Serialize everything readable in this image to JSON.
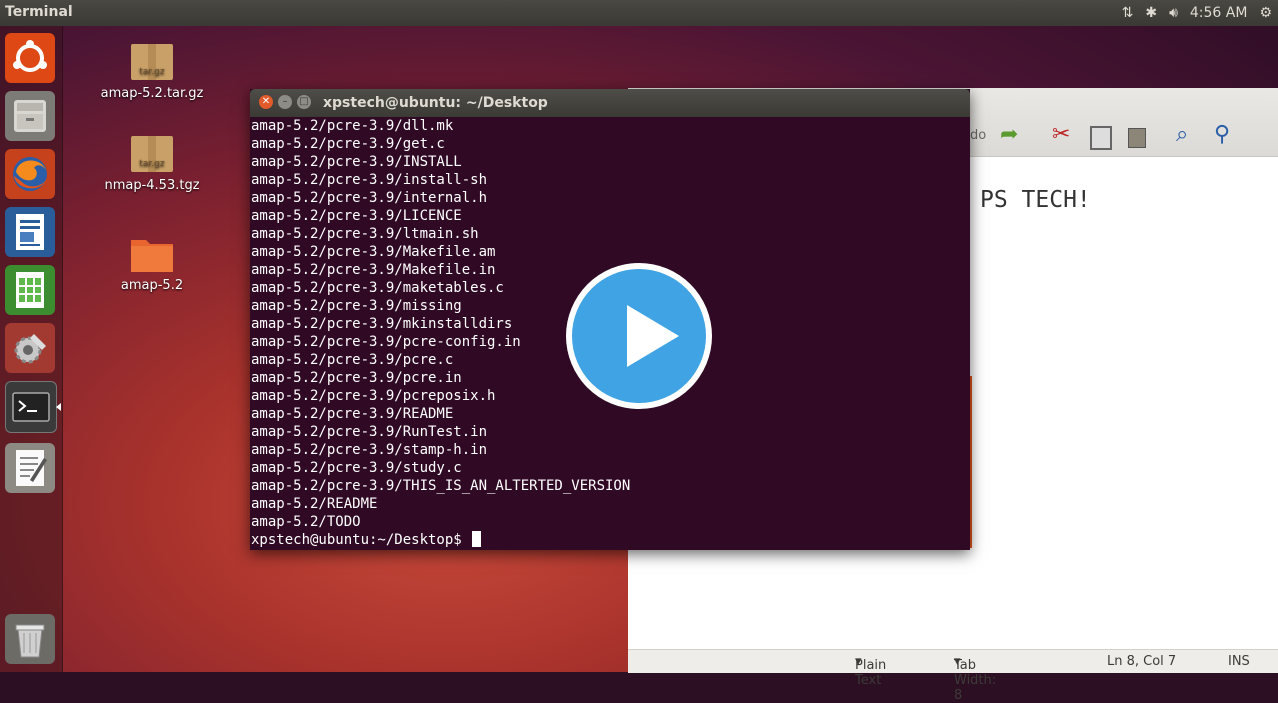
{
  "topbar": {
    "app_title": "Terminal",
    "time": "4:56 AM",
    "icons": [
      "network-icon",
      "bluetooth-icon",
      "volume-icon",
      "gear-icon"
    ]
  },
  "launcher": {
    "items": [
      {
        "name": "ubuntu-dash-icon"
      },
      {
        "name": "files-icon"
      },
      {
        "name": "firefox-icon"
      },
      {
        "name": "writer-icon"
      },
      {
        "name": "calc-icon"
      },
      {
        "name": "system-settings-icon"
      },
      {
        "name": "terminal-icon"
      },
      {
        "name": "text-editor-icon"
      },
      {
        "name": "trash-icon"
      }
    ]
  },
  "desktop": {
    "icons": [
      {
        "label": "amap-5.2.tar.gz",
        "badge": "tar.gz"
      },
      {
        "label": "nmap-4.53.tgz",
        "badge": "tar.gz"
      },
      {
        "label": "amap-5.2"
      }
    ]
  },
  "terminal": {
    "title": "xpstech@ubuntu: ~/Desktop",
    "lines": [
      "amap-5.2/pcre-3.9/dll.mk",
      "amap-5.2/pcre-3.9/get.c",
      "amap-5.2/pcre-3.9/INSTALL",
      "amap-5.2/pcre-3.9/install-sh",
      "amap-5.2/pcre-3.9/internal.h",
      "amap-5.2/pcre-3.9/LICENCE",
      "amap-5.2/pcre-3.9/ltmain.sh",
      "amap-5.2/pcre-3.9/Makefile.am",
      "amap-5.2/pcre-3.9/Makefile.in",
      "amap-5.2/pcre-3.9/maketables.c",
      "amap-5.2/pcre-3.9/missing",
      "amap-5.2/pcre-3.9/mkinstalldirs",
      "amap-5.2/pcre-3.9/pcre-config.in",
      "amap-5.2/pcre-3.9/pcre.c",
      "amap-5.2/pcre-3.9/pcre.in",
      "amap-5.2/pcre-3.9/pcreposix.h",
      "amap-5.2/pcre-3.9/README",
      "amap-5.2/pcre-3.9/RunTest.in",
      "amap-5.2/pcre-3.9/stamp-h.in",
      "amap-5.2/pcre-3.9/study.c",
      "amap-5.2/pcre-3.9/THIS_IS_AN_ALTERTED_VERSION",
      "amap-5.2/README",
      "amap-5.2/TODO"
    ],
    "prompt": "xpstech@ubuntu:~/Desktop$"
  },
  "editor": {
    "toolbar_partial": "do",
    "content_text": "PS TECH!",
    "status": {
      "syntax": "Plain Text",
      "tab_width": "Tab Width: 8",
      "position": "Ln 8, Col 7",
      "mode": "INS"
    }
  },
  "colors": {
    "terminal_bg": "#300a24",
    "play_blue": "#3fa3e4"
  }
}
